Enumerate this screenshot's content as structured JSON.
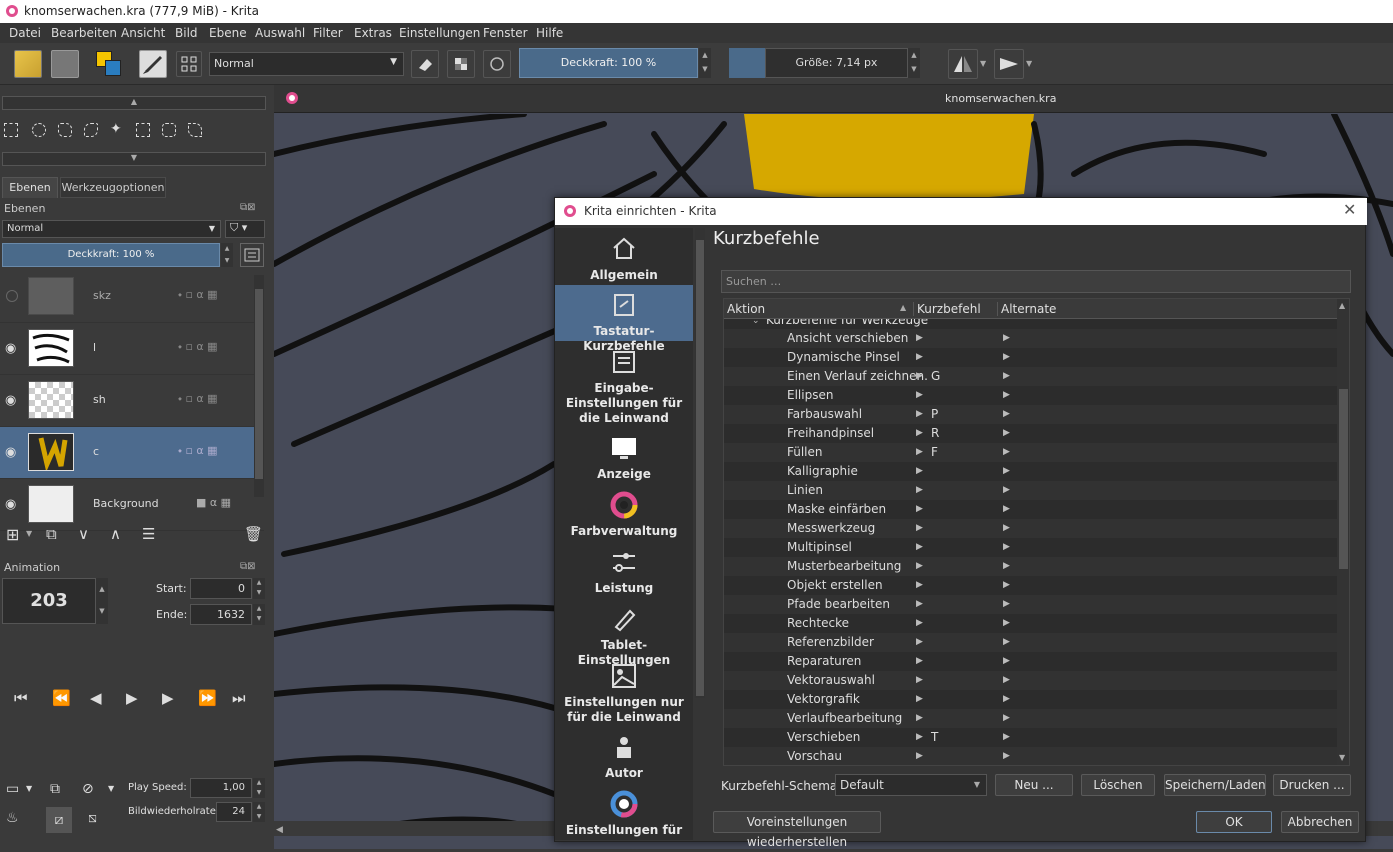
{
  "window": {
    "title": "knomserwachen.kra (777,9 MiB)  - Krita"
  },
  "menu": [
    "Datei",
    "Bearbeiten",
    "Ansicht",
    "Bild",
    "Ebene",
    "Auswahl",
    "Filter",
    "Extras",
    "Einstellungen",
    "Fenster",
    "Hilfe"
  ],
  "toolbar": {
    "blend_mode": "Normal",
    "opacity_label": "Deckkraft: 100 %",
    "size_label": "Größe: 7,14 px"
  },
  "tabs": [
    "Ebenen",
    "Werkzeugoptionen"
  ],
  "layers_panel": {
    "title": "Ebenen",
    "blend_mode": "Normal",
    "opacity": "Deckkraft:  100 %",
    "layers": [
      {
        "name": "skz"
      },
      {
        "name": "l"
      },
      {
        "name": "sh"
      },
      {
        "name": "c"
      },
      {
        "name": "Background"
      }
    ]
  },
  "animation": {
    "title": "Animation",
    "frame": "203",
    "start_label": "Start:",
    "start": "0",
    "end_label": "Ende:",
    "end": "1632",
    "play_speed_label": "Play Speed:",
    "play_speed": "1,00",
    "fps_label": "Bildwiederholrate:",
    "fps": "24"
  },
  "document": {
    "tab": "knomserwachen.kra"
  },
  "dialog": {
    "title": "Krita einrichten - Krita",
    "heading": "Kurzbefehle",
    "search_placeholder": "Suchen …",
    "nav": [
      "Allgemein",
      "Tastatur-Kurzbefehle",
      "Eingabe-Einstellungen für die Leinwand",
      "Anzeige",
      "Farbverwaltung",
      "Leistung",
      "Tablet-Einstellungen",
      "Einstellungen nur für die Leinwand",
      "Autor",
      "Einstellungen für"
    ],
    "columns": [
      "Aktion",
      "Kurzbefehl",
      "Alternate"
    ],
    "group": "Kurzbefehle für Werkzeuge",
    "rows": [
      {
        "name": "Ansicht verschieben",
        "key": ""
      },
      {
        "name": "Dynamische Pinsel",
        "key": ""
      },
      {
        "name": "Einen Verlauf zeichnen.",
        "key": "G"
      },
      {
        "name": "Ellipsen",
        "key": ""
      },
      {
        "name": "Farbauswahl",
        "key": "P"
      },
      {
        "name": "Freihandpinsel",
        "key": "R"
      },
      {
        "name": "Füllen",
        "key": "F"
      },
      {
        "name": "Kalligraphie",
        "key": ""
      },
      {
        "name": "Linien",
        "key": ""
      },
      {
        "name": "Maske einfärben",
        "key": ""
      },
      {
        "name": "Messwerkzeug",
        "key": ""
      },
      {
        "name": "Multipinsel",
        "key": ""
      },
      {
        "name": "Musterbearbeitung",
        "key": ""
      },
      {
        "name": "Objekt erstellen",
        "key": ""
      },
      {
        "name": "Pfade bearbeiten",
        "key": ""
      },
      {
        "name": "Rechtecke",
        "key": ""
      },
      {
        "name": "Referenzbilder",
        "key": ""
      },
      {
        "name": "Reparaturen",
        "key": ""
      },
      {
        "name": "Vektorauswahl",
        "key": ""
      },
      {
        "name": "Vektorgrafik",
        "key": ""
      },
      {
        "name": "Verlaufbearbeitung",
        "key": ""
      },
      {
        "name": "Verschieben",
        "key": "T"
      },
      {
        "name": "Vorschau",
        "key": ""
      }
    ],
    "scheme_label": "Kurzbefehl-Schemata:",
    "scheme": "Default",
    "buttons": {
      "new": "Neu ...",
      "delete": "Löschen",
      "saveload": "Speichern/Laden",
      "print": "Drucken ...",
      "restore": "Voreinstellungen wiederherstellen",
      "ok": "OK",
      "cancel": "Abbrechen"
    }
  }
}
